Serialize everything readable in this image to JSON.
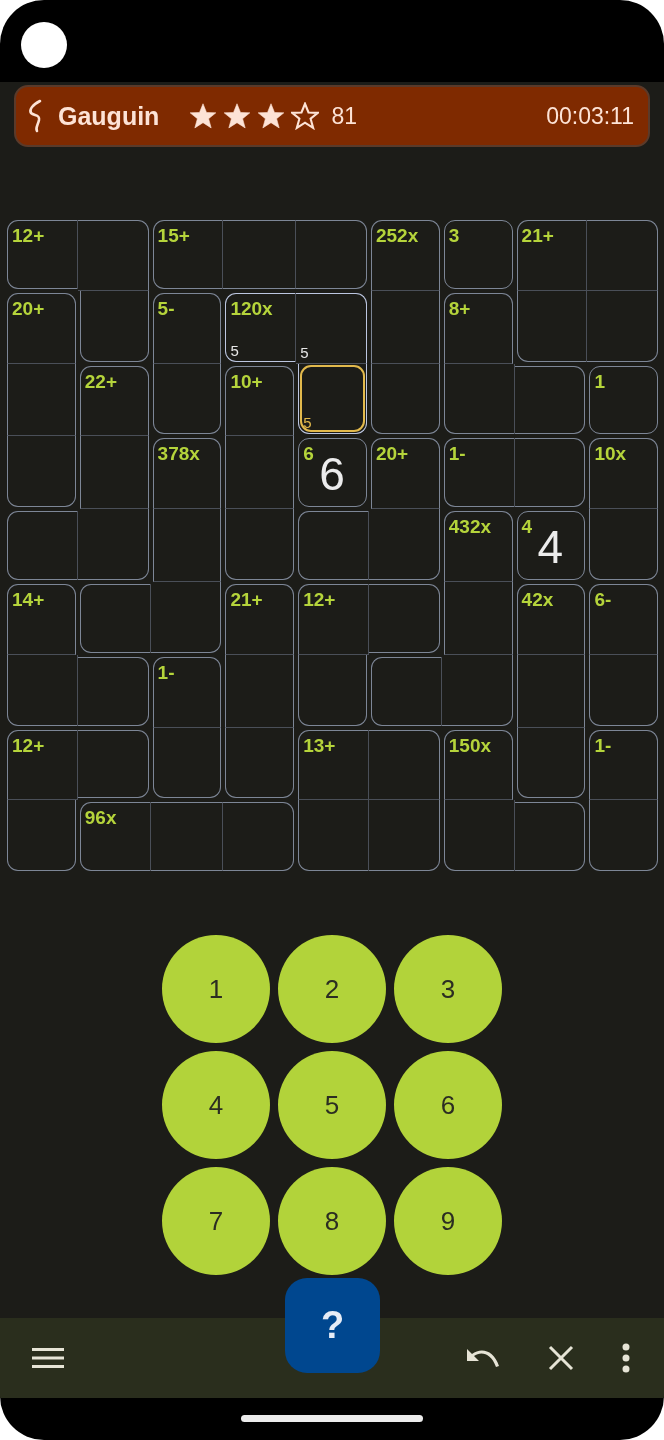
{
  "header": {
    "title": "Gauguin",
    "stars": 3,
    "score": "81",
    "timer": "00:03:11"
  },
  "grid": {
    "cells": [
      [
        {
          "cage_label": "12+",
          "right_wall": false,
          "bottom_wall": true,
          "highlighted": false,
          "selected": false
        },
        {
          "right_wall": true,
          "bottom_wall": false,
          "highlighted": false,
          "selected": false
        },
        {
          "cage_label": "15+",
          "right_wall": false,
          "bottom_wall": true,
          "highlighted": false,
          "selected": false
        },
        {
          "right_wall": false,
          "bottom_wall": true,
          "highlighted": false,
          "selected": false
        },
        {
          "right_wall": true,
          "bottom_wall": true,
          "highlighted": false,
          "selected": false
        },
        {
          "cage_label": "252x",
          "right_wall": true,
          "bottom_wall": false,
          "highlighted": false,
          "selected": false
        },
        {
          "cage_label": "3",
          "right_wall": true,
          "bottom_wall": true,
          "highlighted": false,
          "selected": false
        },
        {
          "cage_label": "21+",
          "right_wall": false,
          "bottom_wall": false,
          "highlighted": false,
          "selected": false
        },
        {
          "right_wall": true,
          "bottom_wall": false,
          "highlighted": false,
          "selected": false
        }
      ],
      [
        {
          "cage_label": "20+",
          "right_wall": true,
          "bottom_wall": false,
          "highlighted": false,
          "selected": false
        },
        {
          "right_wall": true,
          "bottom_wall": true,
          "highlighted": false,
          "selected": false
        },
        {
          "cage_label": "5-",
          "right_wall": true,
          "bottom_wall": false,
          "highlighted": false,
          "selected": false
        },
        {
          "cage_label": "120x",
          "notes": "5",
          "right_wall": false,
          "bottom_wall": true,
          "highlighted": true,
          "selected": false
        },
        {
          "notes": "5",
          "right_wall": true,
          "bottom_wall": false,
          "highlighted": true,
          "selected": false
        },
        {
          "right_wall": true,
          "bottom_wall": false,
          "highlighted": false,
          "selected": false
        },
        {
          "cage_label": "8+",
          "right_wall": true,
          "bottom_wall": false,
          "highlighted": false,
          "selected": false
        },
        {
          "right_wall": false,
          "bottom_wall": true,
          "highlighted": false,
          "selected": false
        },
        {
          "right_wall": true,
          "bottom_wall": true,
          "highlighted": false,
          "selected": false
        }
      ],
      [
        {
          "right_wall": true,
          "bottom_wall": false,
          "highlighted": false,
          "selected": false
        },
        {
          "cage_label": "22+",
          "right_wall": true,
          "bottom_wall": false,
          "highlighted": false,
          "selected": false
        },
        {
          "right_wall": true,
          "bottom_wall": true,
          "highlighted": false,
          "selected": false
        },
        {
          "cage_label": "10+",
          "right_wall": true,
          "bottom_wall": false,
          "highlighted": false,
          "selected": false
        },
        {
          "notes": "5",
          "right_wall": true,
          "bottom_wall": true,
          "highlighted": true,
          "selected": true
        },
        {
          "right_wall": true,
          "bottom_wall": true,
          "highlighted": false,
          "selected": false
        },
        {
          "right_wall": false,
          "bottom_wall": true,
          "highlighted": false,
          "selected": false
        },
        {
          "right_wall": true,
          "bottom_wall": true,
          "highlighted": false,
          "selected": false
        },
        {
          "cage_label": "1",
          "right_wall": true,
          "bottom_wall": true,
          "highlighted": false,
          "selected": false
        }
      ],
      [
        {
          "right_wall": true,
          "bottom_wall": true,
          "highlighted": false,
          "selected": false
        },
        {
          "right_wall": true,
          "bottom_wall": false,
          "highlighted": false,
          "selected": false
        },
        {
          "cage_label": "378x",
          "right_wall": true,
          "bottom_wall": false,
          "highlighted": false,
          "selected": false
        },
        {
          "right_wall": true,
          "bottom_wall": false,
          "highlighted": false,
          "selected": false
        },
        {
          "cage_label": "6",
          "value": "6",
          "right_wall": true,
          "bottom_wall": true,
          "highlighted": false,
          "selected": false
        },
        {
          "cage_label": "20+",
          "right_wall": true,
          "bottom_wall": false,
          "highlighted": false,
          "selected": false
        },
        {
          "cage_label": "1-",
          "right_wall": false,
          "bottom_wall": true,
          "highlighted": false,
          "selected": false
        },
        {
          "right_wall": true,
          "bottom_wall": true,
          "highlighted": false,
          "selected": false
        },
        {
          "cage_label": "10x",
          "right_wall": true,
          "bottom_wall": false,
          "highlighted": false,
          "selected": false
        }
      ],
      [
        {
          "right_wall": false,
          "bottom_wall": true,
          "highlighted": false,
          "selected": false
        },
        {
          "right_wall": true,
          "bottom_wall": true,
          "highlighted": false,
          "selected": false
        },
        {
          "right_wall": true,
          "bottom_wall": false,
          "highlighted": false,
          "selected": false
        },
        {
          "right_wall": true,
          "bottom_wall": true,
          "highlighted": false,
          "selected": false
        },
        {
          "right_wall": false,
          "bottom_wall": true,
          "highlighted": false,
          "selected": false
        },
        {
          "right_wall": true,
          "bottom_wall": true,
          "highlighted": false,
          "selected": false
        },
        {
          "cage_label": "432x",
          "right_wall": true,
          "bottom_wall": false,
          "highlighted": false,
          "selected": false
        },
        {
          "cage_label": "4",
          "value": "4",
          "right_wall": true,
          "bottom_wall": true,
          "highlighted": false,
          "selected": false
        },
        {
          "right_wall": true,
          "bottom_wall": true,
          "highlighted": false,
          "selected": false
        }
      ],
      [
        {
          "cage_label": "14+",
          "right_wall": true,
          "bottom_wall": false,
          "highlighted": false,
          "selected": false
        },
        {
          "right_wall": false,
          "bottom_wall": true,
          "highlighted": false,
          "selected": false
        },
        {
          "right_wall": true,
          "bottom_wall": true,
          "highlighted": false,
          "selected": false
        },
        {
          "cage_label": "21+",
          "right_wall": true,
          "bottom_wall": false,
          "highlighted": false,
          "selected": false
        },
        {
          "cage_label": "12+",
          "right_wall": false,
          "bottom_wall": false,
          "highlighted": false,
          "selected": false
        },
        {
          "right_wall": true,
          "bottom_wall": true,
          "highlighted": false,
          "selected": false
        },
        {
          "right_wall": true,
          "bottom_wall": false,
          "highlighted": false,
          "selected": false
        },
        {
          "cage_label": "42x",
          "right_wall": true,
          "bottom_wall": false,
          "highlighted": false,
          "selected": false
        },
        {
          "cage_label": "6-",
          "right_wall": true,
          "bottom_wall": false,
          "highlighted": false,
          "selected": false
        }
      ],
      [
        {
          "right_wall": false,
          "bottom_wall": true,
          "highlighted": false,
          "selected": false
        },
        {
          "right_wall": true,
          "bottom_wall": true,
          "highlighted": false,
          "selected": false
        },
        {
          "cage_label": "1-",
          "right_wall": true,
          "bottom_wall": false,
          "highlighted": false,
          "selected": false
        },
        {
          "right_wall": true,
          "bottom_wall": false,
          "highlighted": false,
          "selected": false
        },
        {
          "right_wall": true,
          "bottom_wall": true,
          "highlighted": false,
          "selected": false
        },
        {
          "right_wall": false,
          "bottom_wall": true,
          "highlighted": false,
          "selected": false
        },
        {
          "right_wall": true,
          "bottom_wall": true,
          "highlighted": false,
          "selected": false
        },
        {
          "right_wall": true,
          "bottom_wall": false,
          "highlighted": false,
          "selected": false
        },
        {
          "right_wall": true,
          "bottom_wall": true,
          "highlighted": false,
          "selected": false
        }
      ],
      [
        {
          "cage_label": "12+",
          "right_wall": false,
          "bottom_wall": false,
          "highlighted": false,
          "selected": false
        },
        {
          "right_wall": true,
          "bottom_wall": true,
          "highlighted": false,
          "selected": false
        },
        {
          "right_wall": true,
          "bottom_wall": true,
          "highlighted": false,
          "selected": false
        },
        {
          "right_wall": true,
          "bottom_wall": true,
          "highlighted": false,
          "selected": false
        },
        {
          "cage_label": "13+",
          "right_wall": false,
          "bottom_wall": false,
          "highlighted": false,
          "selected": false
        },
        {
          "right_wall": true,
          "bottom_wall": false,
          "highlighted": false,
          "selected": false
        },
        {
          "cage_label": "150x",
          "right_wall": true,
          "bottom_wall": false,
          "highlighted": false,
          "selected": false
        },
        {
          "right_wall": true,
          "bottom_wall": true,
          "highlighted": false,
          "selected": false
        },
        {
          "cage_label": "1-",
          "right_wall": true,
          "bottom_wall": false,
          "highlighted": false,
          "selected": false
        }
      ],
      [
        {
          "right_wall": true,
          "bottom_wall": true,
          "highlighted": false,
          "selected": false
        },
        {
          "cage_label": "96x",
          "right_wall": false,
          "bottom_wall": true,
          "highlighted": false,
          "selected": false
        },
        {
          "right_wall": false,
          "bottom_wall": true,
          "highlighted": false,
          "selected": false
        },
        {
          "right_wall": true,
          "bottom_wall": true,
          "highlighted": false,
          "selected": false
        },
        {
          "right_wall": false,
          "bottom_wall": true,
          "highlighted": false,
          "selected": false
        },
        {
          "right_wall": true,
          "bottom_wall": true,
          "highlighted": false,
          "selected": false
        },
        {
          "right_wall": false,
          "bottom_wall": true,
          "highlighted": false,
          "selected": false
        },
        {
          "right_wall": true,
          "bottom_wall": true,
          "highlighted": false,
          "selected": false
        },
        {
          "right_wall": true,
          "bottom_wall": true,
          "highlighted": false,
          "selected": false
        }
      ]
    ]
  },
  "keypad": [
    "1",
    "2",
    "3",
    "4",
    "5",
    "6",
    "7",
    "8",
    "9"
  ],
  "help_button": "?"
}
